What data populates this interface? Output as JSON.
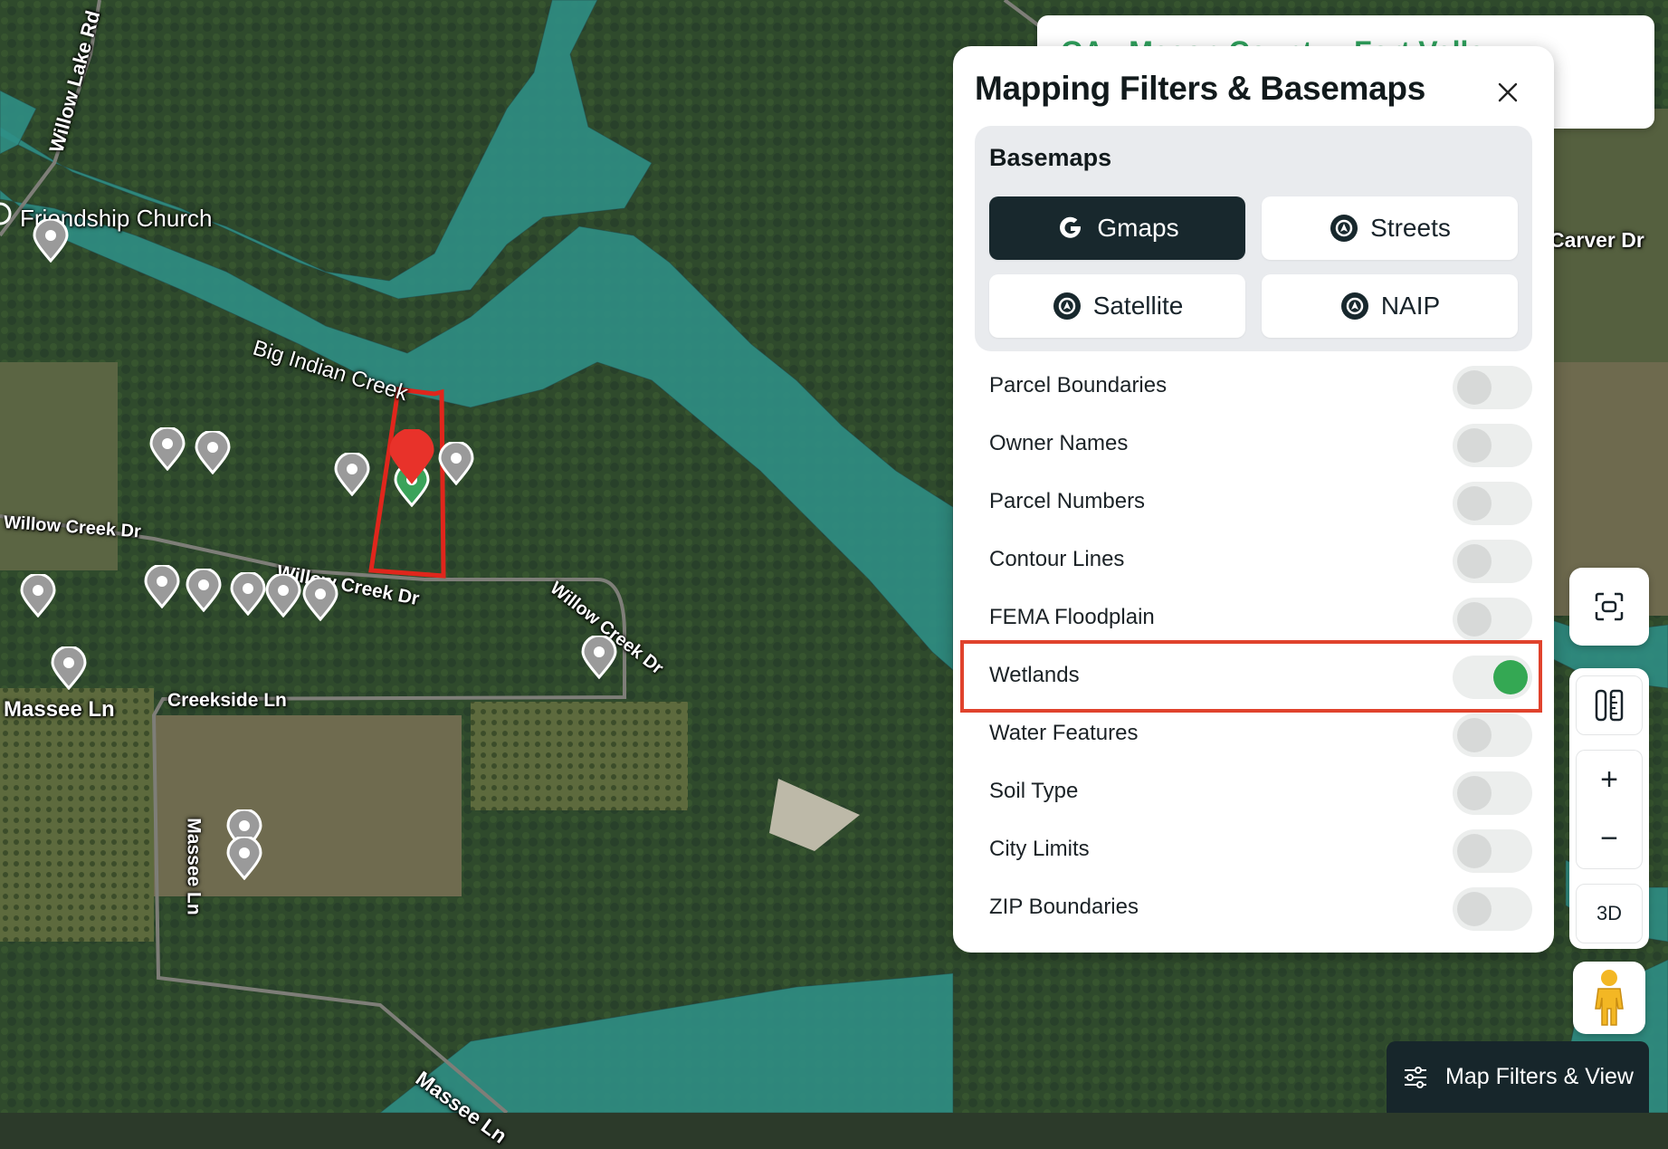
{
  "map": {
    "labels": {
      "willow_lake_rd": "Willow Lake Rd",
      "friendship_church": "Friendship Church",
      "big_indian_creek": "Big Indian Creek",
      "willow_creek_dr_west": "Willow Creek Dr",
      "willow_creek_dr_mid": "Willow Creek Dr",
      "willow_creek_dr_east": "Willow Creek Dr",
      "massee_ln_west": "Massee Ln",
      "creekside_ln": "Creekside Ln",
      "massee_ln_vertical": "Massee Ln",
      "massee_ln_south": "Massee Ln",
      "carver_dr": "Carver Dr"
    },
    "colors": {
      "wetland": "#2f8f86",
      "forest": "#2f4a2c",
      "field": "#6b6a4e",
      "parcel_outline": "#e0261c"
    }
  },
  "info_card": {
    "title": "GA - Macon County - Fort Valley"
  },
  "panel": {
    "title": "Mapping Filters & Basemaps",
    "basemaps": {
      "title": "Basemaps",
      "options": [
        {
          "label": "Gmaps",
          "active": true,
          "icon": "google-g-icon"
        },
        {
          "label": "Streets",
          "active": false,
          "icon": "compass-icon"
        },
        {
          "label": "Satellite",
          "active": false,
          "icon": "compass-icon"
        },
        {
          "label": "NAIP",
          "active": false,
          "icon": "compass-icon"
        }
      ]
    },
    "layers": [
      {
        "label": "Parcel Boundaries",
        "on": false
      },
      {
        "label": "Owner Names",
        "on": false
      },
      {
        "label": "Parcel Numbers",
        "on": false
      },
      {
        "label": "Contour Lines",
        "on": false
      },
      {
        "label": "FEMA Floodplain",
        "on": false
      },
      {
        "label": "Wetlands",
        "on": true
      },
      {
        "label": "Water Features",
        "on": false
      },
      {
        "label": "Soil Type",
        "on": false
      },
      {
        "label": "City Limits",
        "on": false
      },
      {
        "label": "ZIP Boundaries",
        "on": false
      }
    ]
  },
  "controls": {
    "zoom_in": "+",
    "zoom_out": "−",
    "three_d": "3D"
  },
  "bottom_button": {
    "label": "Map Filters & View"
  }
}
